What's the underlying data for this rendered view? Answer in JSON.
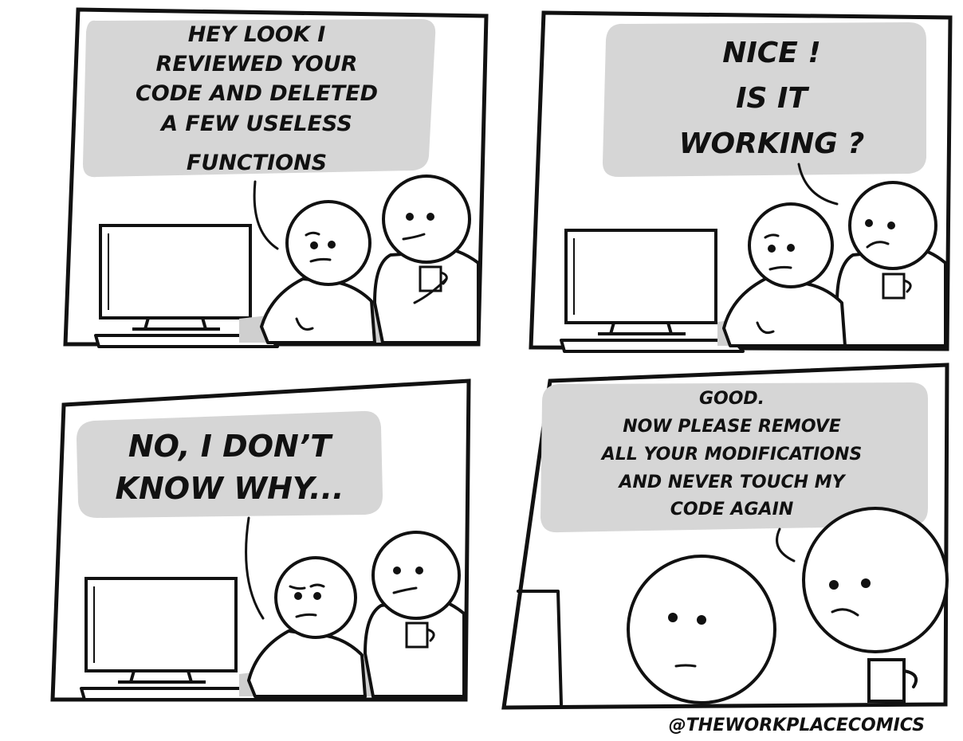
{
  "comic": {
    "panels": [
      {
        "dialogue": [
          "HEY LOOK I",
          "REVIEWED YOUR",
          "CODE AND DELETED",
          "A FEW USELESS",
          "FUNCTIONS"
        ]
      },
      {
        "dialogue": [
          "NICE !",
          "IS IT",
          "WORKING ?"
        ]
      },
      {
        "dialogue": [
          "NO, I DON’T",
          "KNOW WHY..."
        ]
      },
      {
        "dialogue": [
          "GOOD.",
          "NOW PLEASE REMOVE",
          "ALL YOUR MODIFICATIONS",
          "AND NEVER TOUCH MY",
          "CODE AGAIN"
        ]
      }
    ],
    "credit": "@THEWORKPLACECOMICS"
  }
}
